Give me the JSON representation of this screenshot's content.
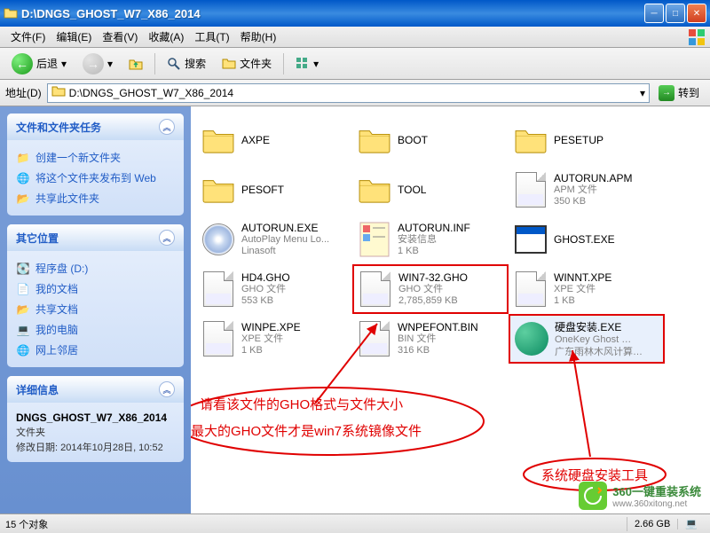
{
  "window": {
    "title": "D:\\DNGS_GHOST_W7_X86_2014"
  },
  "menu": {
    "items": [
      "文件(F)",
      "编辑(E)",
      "查看(V)",
      "收藏(A)",
      "工具(T)",
      "帮助(H)"
    ]
  },
  "toolbar": {
    "back": "后退",
    "search": "搜索",
    "folders": "文件夹"
  },
  "address": {
    "label": "地址(D)",
    "path": "D:\\DNGS_GHOST_W7_X86_2014",
    "goto": "转到"
  },
  "sidebar": {
    "tasks": {
      "title": "文件和文件夹任务",
      "items": [
        "创建一个新文件夹",
        "将这个文件夹发布到 Web",
        "共享此文件夹"
      ]
    },
    "places": {
      "title": "其它位置",
      "items": [
        "程序盘 (D:)",
        "我的文档",
        "共享文档",
        "我的电脑",
        "网上邻居"
      ]
    },
    "details": {
      "title": "详细信息",
      "name": "DNGS_GHOST_W7_X86_2014",
      "type": "文件夹",
      "modified_label": "修改日期:",
      "modified_value": "2014年10月28日, 10:52"
    }
  },
  "files": [
    {
      "name": "AXPE",
      "kind": "folder"
    },
    {
      "name": "BOOT",
      "kind": "folder"
    },
    {
      "name": "PESETUP",
      "kind": "folder"
    },
    {
      "name": "PESOFT",
      "kind": "folder"
    },
    {
      "name": "TOOL",
      "kind": "folder"
    },
    {
      "name": "AUTORUN.APM",
      "kind": "apm",
      "meta1": "APM 文件",
      "meta2": "350 KB"
    },
    {
      "name": "AUTORUN.EXE",
      "kind": "cd",
      "meta1": "AutoPlay Menu Lo...",
      "meta2": "Linasoft"
    },
    {
      "name": "AUTORUN.INF",
      "kind": "inf",
      "meta1": "安装信息",
      "meta2": "1 KB"
    },
    {
      "name": "GHOST.EXE",
      "kind": "app",
      "meta1": "",
      "meta2": ""
    },
    {
      "name": "HD4.GHO",
      "kind": "gho",
      "meta1": "GHO 文件",
      "meta2": "553 KB"
    },
    {
      "name": "WIN7-32.GHO",
      "kind": "gho",
      "meta1": "GHO 文件",
      "meta2": "2,785,859 KB",
      "highlight": true
    },
    {
      "name": "WINNT.XPE",
      "kind": "xpe",
      "meta1": "XPE 文件",
      "meta2": "1 KB"
    },
    {
      "name": "WINPE.XPE",
      "kind": "xpe",
      "meta1": "XPE 文件",
      "meta2": "1 KB"
    },
    {
      "name": "WNPEFONT.BIN",
      "kind": "bin",
      "meta1": "BIN 文件",
      "meta2": "316 KB"
    },
    {
      "name": "硬盘安装.EXE",
      "kind": "greendisc",
      "meta1": "OneKey Ghost …",
      "meta2": "广东雨林木风计算…",
      "highlight": true,
      "selected": true
    }
  ],
  "annotations": {
    "line1": "请看该文件的GHO格式与文件大小",
    "line2": "最大的GHO文件才是win7系统镜像文件",
    "line3": "系统硬盘安装工具"
  },
  "status": {
    "count": "15 个对象",
    "size": "2.66 GB"
  },
  "watermark": {
    "title": "360一键重装系统",
    "url": "www.360xitong.net"
  }
}
